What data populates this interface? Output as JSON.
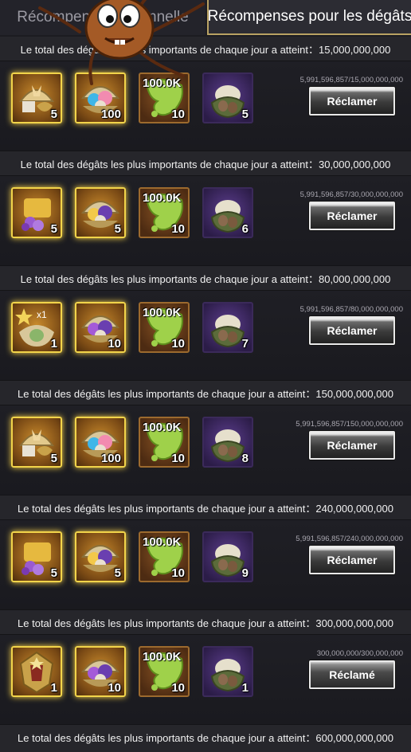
{
  "tabs": {
    "left_label": "Récompense personnelle",
    "right_label": "Récompenses pour les dégâts"
  },
  "tiers": [
    {
      "title": "Le total des dégâts les plus importants de chaque jour a atteint：15,000,000,000",
      "progress": "5,991,596,857/15,000,000,000",
      "button": "Réclamer",
      "items": [
        {
          "icon": "butterfly-fossil-chest",
          "qty": "5"
        },
        {
          "icon": "gem-shell-chest",
          "qty": "100"
        },
        {
          "icon": "green-slime",
          "label": "100.0K",
          "qty": "10"
        },
        {
          "icon": "purple-nest",
          "qty": "5"
        }
      ]
    },
    {
      "title": "Le total des dégâts les plus importants de chaque jour a atteint：30,000,000,000",
      "progress": "5,991,596,857/30,000,000,000",
      "button": "Réclamer",
      "items": [
        {
          "icon": "flower-chest",
          "qty": "5"
        },
        {
          "icon": "sun-shell-chest",
          "qty": "5"
        },
        {
          "icon": "green-slime",
          "label": "100.0K",
          "qty": "10"
        },
        {
          "icon": "purple-nest",
          "qty": "6"
        }
      ]
    },
    {
      "title": "Le total des dégâts les plus importants de chaque jour a atteint：80,000,000,000",
      "progress": "5,991,596,857/80,000,000,000",
      "button": "Réclamer",
      "items": [
        {
          "icon": "star-egg-chest",
          "qty": "1"
        },
        {
          "icon": "purple-gem-shell",
          "qty": "10"
        },
        {
          "icon": "green-slime",
          "label": "100.0K",
          "qty": "10"
        },
        {
          "icon": "purple-nest",
          "qty": "7"
        }
      ]
    },
    {
      "title": "Le total des dégâts les plus importants de chaque jour a atteint：150,000,000,000",
      "progress": "5,991,596,857/150,000,000,000",
      "button": "Réclamer",
      "items": [
        {
          "icon": "butterfly-fossil-chest",
          "qty": "5"
        },
        {
          "icon": "gem-shell-chest",
          "qty": "100"
        },
        {
          "icon": "green-slime",
          "label": "100.0K",
          "qty": "10"
        },
        {
          "icon": "purple-nest",
          "qty": "8"
        }
      ]
    },
    {
      "title": "Le total des dégâts les plus importants de chaque jour a atteint：240,000,000,000",
      "progress": "5,991,596,857/240,000,000,000",
      "button": "Réclamer",
      "items": [
        {
          "icon": "flower-chest",
          "qty": "5"
        },
        {
          "icon": "sun-shell-chest",
          "qty": "5"
        },
        {
          "icon": "green-slime",
          "label": "100.0K",
          "qty": "10"
        },
        {
          "icon": "purple-nest",
          "qty": "9"
        }
      ]
    },
    {
      "title": "Le total des dégâts les plus importants de chaque jour a atteint：300,000,000,000",
      "progress": "300,000,000/300,000,000",
      "button": "Réclamé",
      "items": [
        {
          "icon": "helmet-badge-chest",
          "qty": "1"
        },
        {
          "icon": "purple-gem-shell",
          "qty": "10"
        },
        {
          "icon": "green-slime",
          "label": "100.0K",
          "qty": "10"
        },
        {
          "icon": "purple-nest",
          "qty": "1"
        }
      ]
    }
  ],
  "next_tier_title": "Le total des dégâts les plus importants de chaque jour a atteint：600,000,000,000",
  "colors": {
    "accent_gold": "#f2d44a",
    "tab_border": "#b9a263",
    "background": "#26262b"
  }
}
